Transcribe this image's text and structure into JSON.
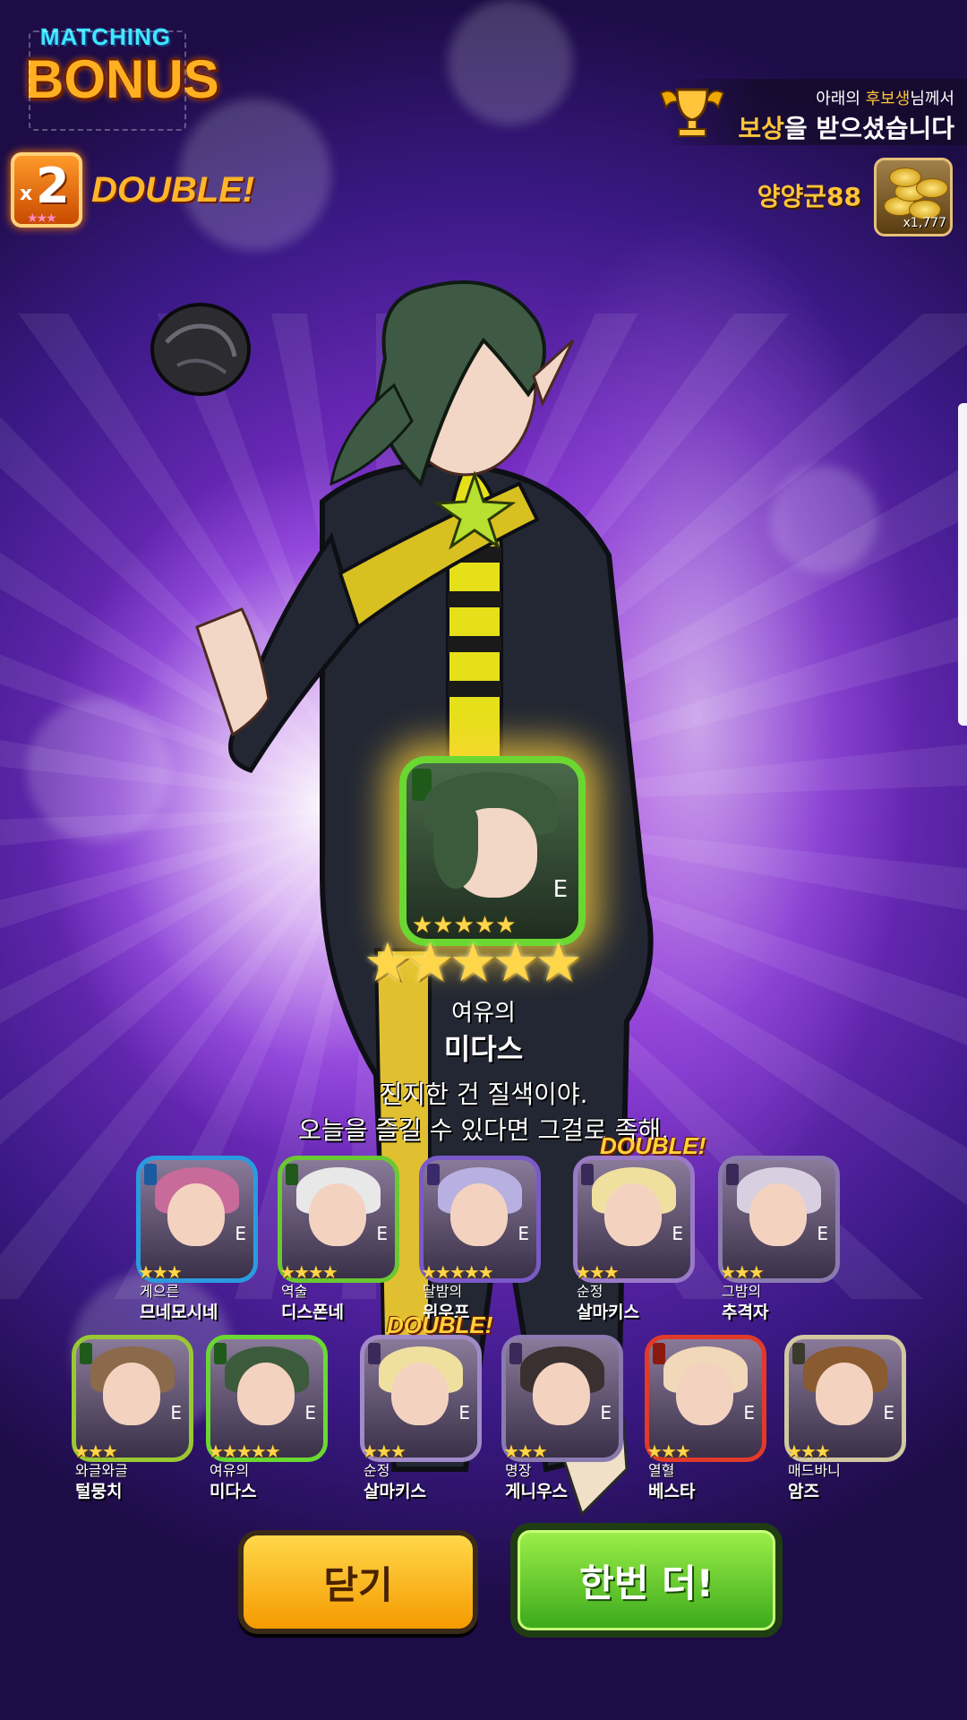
{
  "logo": {
    "matching": "MATCHING",
    "bonus": "BONUS"
  },
  "double_badge": {
    "multiplier": "2",
    "prefix": "x",
    "stars": "★★★",
    "label": "DOUBLE!"
  },
  "reward": {
    "line1_pre": "아래의 ",
    "line1_hl": "후보생",
    "line1_post": "님께서",
    "line2_hl": "보상",
    "line2_post": "을 받으셨습니다",
    "username": "양양군88",
    "gold_count": "x1,777",
    "trophy_icon": "trophy-icon",
    "gold_icon": "gold-coins-icon"
  },
  "featured": {
    "grade": "E",
    "small_stars": "★★★★★",
    "big_stars": "★★★★★",
    "title": "여유의",
    "name": "미다스",
    "quote_line1": "진지한 건 질색이야.",
    "quote_line2": "오늘을 즐길 수 있다면 그걸로 족해.",
    "element_color": "#1f5a1a"
  },
  "row1": [
    {
      "title": "게으른",
      "name": "므네모시네",
      "stars": "★★★",
      "grade": "E",
      "border": "#2a9be0",
      "element": "#1a5aa0",
      "hair": "#c86a9a",
      "double": ""
    },
    {
      "title": "역술",
      "name": "디스폰네",
      "stars": "★★★★",
      "grade": "E",
      "border": "#6ac832",
      "element": "#1f5a1a",
      "hair": "#e8e8e8",
      "double": ""
    },
    {
      "title": "달밤의",
      "name": "위우프",
      "stars": "★★★★★",
      "grade": "E",
      "border": "#7a5ac8",
      "element": "#3a2a6a",
      "hair": "#b8b0e0",
      "double": ""
    },
    {
      "title": "순정",
      "name": "살마키스",
      "stars": "★★★",
      "grade": "E",
      "border": "#9a7ac8",
      "element": "#3a2a5a",
      "hair": "#f0e0a0",
      "double": "DOUBLE!"
    },
    {
      "title": "그밤의",
      "name": "추격자",
      "stars": "★★★",
      "grade": "E",
      "border": "#8a7ab0",
      "element": "#3a2a5a",
      "hair": "#d8d0e0",
      "double": ""
    }
  ],
  "row2": [
    {
      "title": "와글와글",
      "name": "털뭉치",
      "stars": "★★★",
      "grade": "E",
      "border": "#9ac832",
      "element": "#1f5a1a",
      "hair": "#8a6a4a",
      "double": ""
    },
    {
      "title": "여유의",
      "name": "미다스",
      "stars": "★★★★★",
      "grade": "E",
      "border": "#6ad832",
      "element": "#1f5a1a",
      "hair": "#3c5a3c",
      "double": ""
    },
    {
      "title": "순정",
      "name": "살마키스",
      "stars": "★★★",
      "grade": "E",
      "border": "#a08ac8",
      "element": "#3a2a5a",
      "hair": "#f0e0a0",
      "double": "DOUBLE!"
    },
    {
      "title": "명장",
      "name": "게니우스",
      "stars": "★★★",
      "grade": "E",
      "border": "#8a7ab0",
      "element": "#3a2a5a",
      "hair": "#3a3030",
      "double": ""
    },
    {
      "title": "열혈",
      "name": "베스타",
      "stars": "★★★",
      "grade": "E",
      "border": "#e03a2a",
      "element": "#8a1a10",
      "hair": "#f0d8b8",
      "double": ""
    },
    {
      "title": "매드바니",
      "name": "암즈",
      "stars": "★★★",
      "grade": "E",
      "border": "#d0c8a0",
      "element": "#3a3a2a",
      "hair": "#8a5a30",
      "double": ""
    }
  ],
  "buttons": {
    "close": "닫기",
    "again": "한번 더!"
  },
  "colors": {
    "accent_gold": "#ffc43a",
    "button_yellow": "#f5a800",
    "button_green": "#3aa81a"
  }
}
